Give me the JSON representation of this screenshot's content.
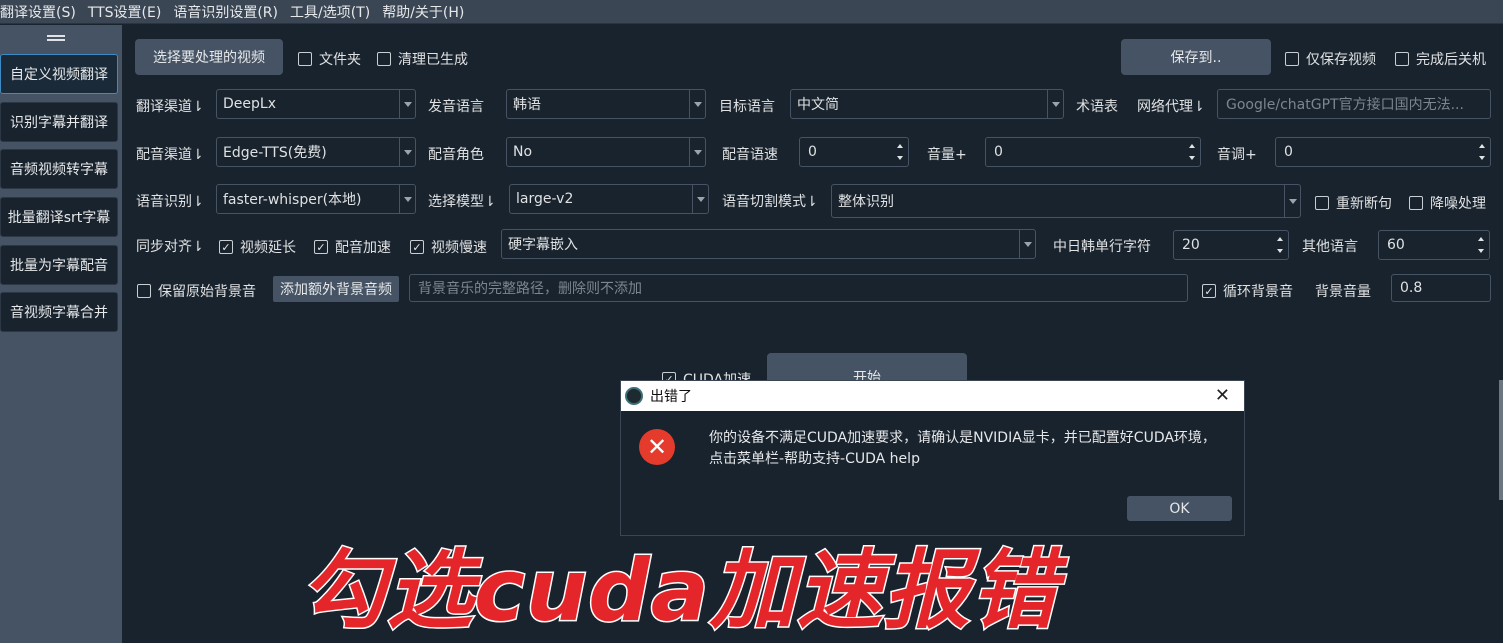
{
  "menu": [
    "翻译设置(S)",
    "TTS设置(E)",
    "语音识别设置(R)",
    "工具/选项(T)",
    "帮助/关于(H)"
  ],
  "sidebar": {
    "items": [
      "自定义视频翻译",
      "识别字幕并翻译",
      "音频视频转字幕",
      "批量翻译srt字幕",
      "批量为字幕配音",
      "音视频字幕合并"
    ]
  },
  "row1": {
    "select_video": "选择要处理的视频",
    "folder": "文件夹",
    "clear_generated": "清理已生成",
    "save_to": "保存到..",
    "only_save_video": "仅保存视频",
    "shutdown_after": "完成后关机"
  },
  "row2": {
    "trans_channel_label": "翻译渠道⇂",
    "trans_channel_value": "DeepLx",
    "voice_lang_label": "发音语言",
    "voice_lang_value": "韩语",
    "target_lang_label": "目标语言",
    "target_lang_value": "中文简",
    "glossary_label": "术语表",
    "proxy_label": "网络代理⇂",
    "proxy_placeholder": "Google/chatGPT官方接口国内无法..."
  },
  "row3": {
    "dub_channel_label": "配音渠道⇂",
    "dub_channel_value": "Edge-TTS(免费)",
    "dub_role_label": "配音角色",
    "dub_role_value": "No",
    "dub_speed_label": "配音语速",
    "dub_speed_value": "0",
    "volume_label": "音量+",
    "volume_value": "0",
    "pitch_label": "音调+",
    "pitch_value": "0"
  },
  "row4": {
    "asr_label": "语音识别⇂",
    "asr_value": "faster-whisper(本地)",
    "model_label": "选择模型⇂",
    "model_value": "large-v2",
    "split_mode_label": "语音切割模式⇂",
    "split_mode_value": "整体识别",
    "resegment": "重新断句",
    "denoise": "降噪处理"
  },
  "row5": {
    "sync_label": "同步对齐⇂",
    "video_extend": "视频延长",
    "dub_accelerate": "配音加速",
    "video_slow": "视频慢速",
    "subtitle_mode_value": "硬字幕嵌入",
    "cjk_chars_label": "中日韩单行字符",
    "cjk_chars_value": "20",
    "other_lang_label": "其他语言",
    "other_lang_value": "60"
  },
  "row6": {
    "keep_bg": "保留原始背景音",
    "add_bg_button": "添加额外背景音频",
    "bg_path_placeholder": "背景音乐的完整路径，删除则不添加",
    "loop_bg": "循环背景音",
    "bg_volume_label": "背景音量",
    "bg_volume_value": "0.8"
  },
  "bottom": {
    "cuda": "CUDA加速",
    "start": "开始"
  },
  "dialog": {
    "title": "出错了",
    "message": "你的设备不满足CUDA加速要求，请确认是NVIDIA显卡，并已配置好CUDA环境，点击菜单栏-帮助支持-CUDA help",
    "ok": "OK"
  },
  "overlay": "勾选cuda加速报错",
  "colors": {
    "background": "#19232d",
    "sidebar": "#455364",
    "button": "#455364",
    "accent_border": "#3c8bc5",
    "error": "#e53b2c",
    "overlay_text": "#e4262b"
  }
}
